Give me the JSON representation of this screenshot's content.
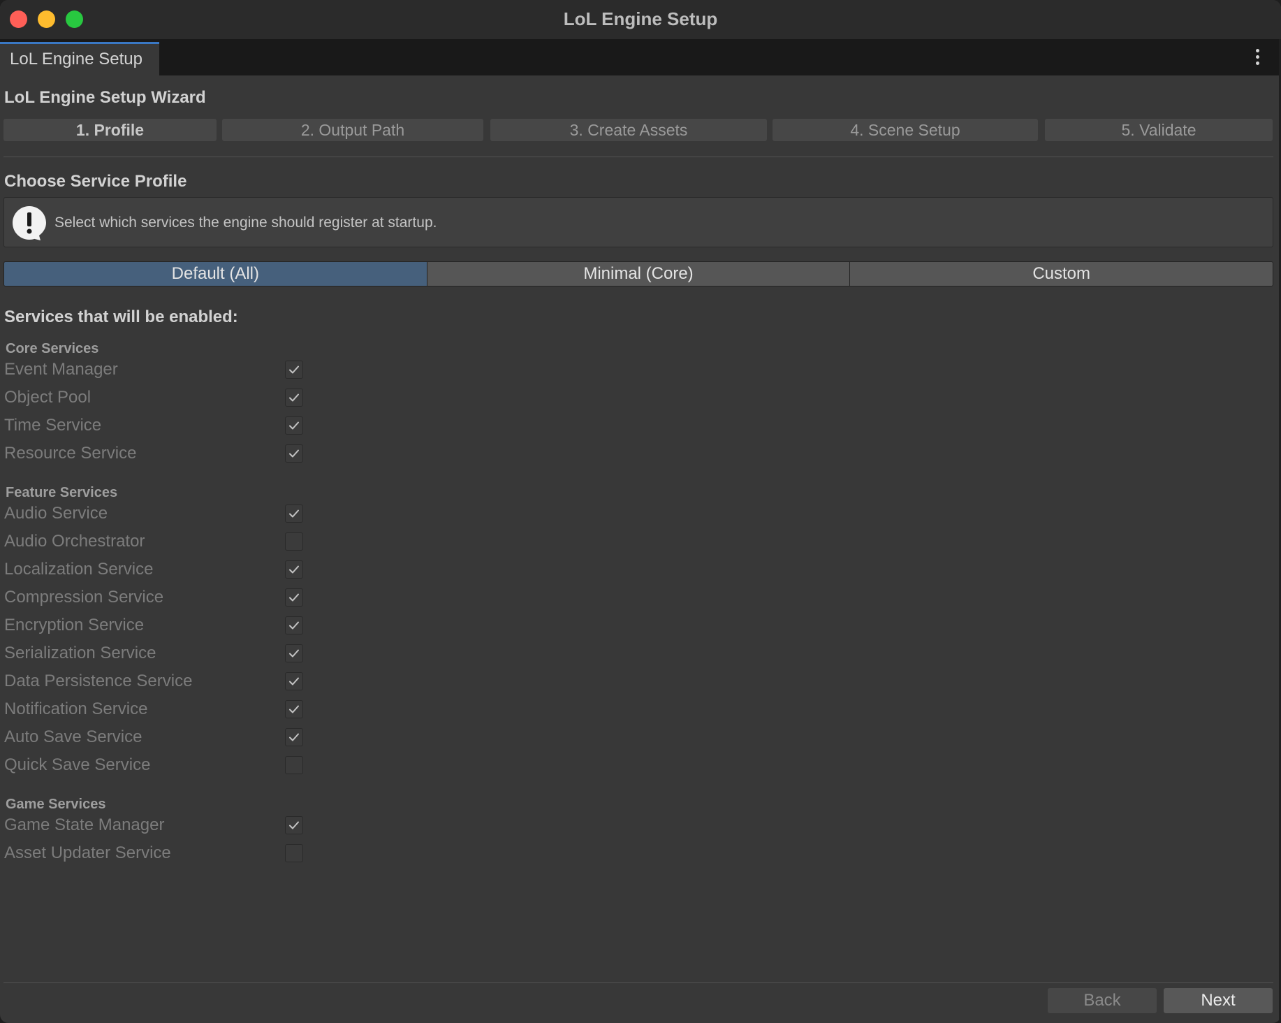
{
  "window": {
    "title": "LoL Engine Setup"
  },
  "tab": {
    "label": "LoL Engine Setup"
  },
  "wizard": {
    "title": "LoL Engine Setup Wizard",
    "steps": [
      {
        "label": "1. Profile",
        "active": true
      },
      {
        "label": "2. Output Path",
        "active": false
      },
      {
        "label": "3. Create Assets",
        "active": false
      },
      {
        "label": "4. Scene Setup",
        "active": false
      },
      {
        "label": "5. Validate",
        "active": false
      }
    ]
  },
  "profile_section": {
    "title": "Choose Service Profile",
    "help_text": "Select which services the engine should register at startup.",
    "options": [
      "Default (All)",
      "Minimal (Core)",
      "Custom"
    ],
    "selected": "Default (All)"
  },
  "services": {
    "title": "Services that will be enabled:",
    "groups": [
      {
        "name": "Core Services",
        "items": [
          {
            "label": "Event Manager",
            "checked": true
          },
          {
            "label": "Object Pool",
            "checked": true
          },
          {
            "label": "Time Service",
            "checked": true
          },
          {
            "label": "Resource Service",
            "checked": true
          }
        ]
      },
      {
        "name": "Feature Services",
        "items": [
          {
            "label": "Audio Service",
            "checked": true
          },
          {
            "label": "Audio Orchestrator",
            "checked": false
          },
          {
            "label": "Localization Service",
            "checked": true
          },
          {
            "label": "Compression Service",
            "checked": true
          },
          {
            "label": "Encryption Service",
            "checked": true
          },
          {
            "label": "Serialization Service",
            "checked": true
          },
          {
            "label": "Data Persistence Service",
            "checked": true
          },
          {
            "label": "Notification Service",
            "checked": true
          },
          {
            "label": "Auto Save Service",
            "checked": true
          },
          {
            "label": "Quick Save Service",
            "checked": false
          }
        ]
      },
      {
        "name": "Game Services",
        "items": [
          {
            "label": "Game State Manager",
            "checked": true
          },
          {
            "label": "Asset Updater Service",
            "checked": false
          }
        ]
      }
    ]
  },
  "footer": {
    "back_label": "Back",
    "next_label": "Next"
  },
  "colors": {
    "window_bg": "#383838",
    "selected_profile": "#46607c",
    "close": "#ff5f57",
    "minimize": "#febc2e",
    "zoom": "#28c840"
  },
  "icons": {
    "info": "exclamation-speech-bubble-icon",
    "menu": "vertical-ellipsis-icon",
    "check": "checkmark-icon"
  }
}
